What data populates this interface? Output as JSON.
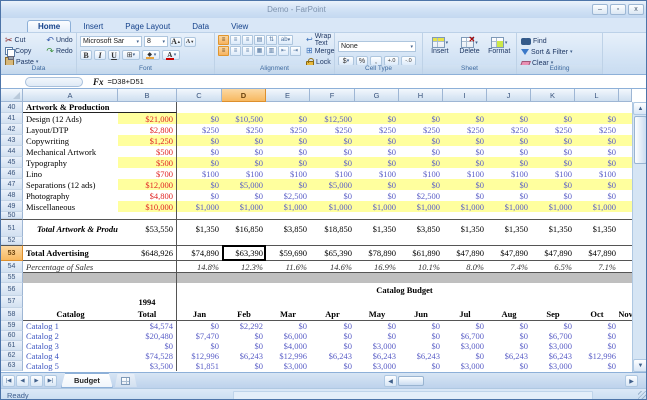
{
  "window": {
    "title": "Demo - FarPoint",
    "controls": {
      "minimize": "–",
      "maximize": "▫",
      "close": "x"
    }
  },
  "ribbon": {
    "tabs": [
      "Home",
      "Insert",
      "Page Layout",
      "Data",
      "View"
    ],
    "active_tab": "Home",
    "data_group": {
      "label": "Data",
      "cut": "Cut",
      "copy": "Copy",
      "paste": "Paste",
      "undo": "Undo",
      "redo": "Redo"
    },
    "font_group": {
      "label": "Font",
      "font_name": "Microsoft Sar",
      "font_size": "8"
    },
    "align_group": {
      "label": "Alignment",
      "wrap": "Wrap Text",
      "merge": "Merge",
      "lock": "Lock"
    },
    "cell_type_group": {
      "label": "Cell Type",
      "value": "None",
      "currency": "$",
      "percent": "%",
      "comma": ",",
      "inc_decimal": "+.0",
      "dec_decimal": "-.0"
    },
    "sheet_group": {
      "label": "Sheet",
      "insert": "Insert",
      "delete": "Delete",
      "format": "Format"
    },
    "editing_group": {
      "label": "Editing",
      "find": "Find",
      "sort": "Sort & Filter",
      "clear": "Clear"
    }
  },
  "formula_bar": {
    "name_box": "",
    "fx_label": "Fx",
    "formula": "=D38+D51"
  },
  "sheet": {
    "selected": {
      "col": "D",
      "row": 53
    },
    "columns": [
      {
        "key": "RH",
        "label": "",
        "w": 22
      },
      {
        "key": "A",
        "label": "A",
        "w": 95
      },
      {
        "key": "B",
        "label": "B",
        "w": 59
      },
      {
        "key": "C",
        "label": "C",
        "w": 45
      },
      {
        "key": "D",
        "label": "D",
        "w": 44
      },
      {
        "key": "E",
        "label": "E",
        "w": 44
      },
      {
        "key": "F",
        "label": "F",
        "w": 45
      },
      {
        "key": "G",
        "label": "G",
        "w": 44
      },
      {
        "key": "H",
        "label": "H",
        "w": 44
      },
      {
        "key": "I",
        "label": "I",
        "w": 44
      },
      {
        "key": "J",
        "label": "J",
        "w": 44
      },
      {
        "key": "K",
        "label": "K",
        "w": 44
      },
      {
        "key": "L",
        "label": "L",
        "w": 44
      },
      {
        "key": "M",
        "label": "",
        "w": 13
      }
    ],
    "rows": [
      {
        "n": 40,
        "h": 11,
        "ul": true,
        "cells": {
          "A": [
            "Artwork & Production",
            "title"
          ]
        }
      },
      {
        "n": 41,
        "h": 11,
        "band": true,
        "cells": {
          "A": [
            "Design (12 Ads)",
            "lab"
          ],
          "B": [
            "$21,000",
            "red"
          ],
          "C": [
            "$0",
            "val"
          ],
          "D": [
            "$10,500",
            "val"
          ],
          "E": [
            "$0",
            "val"
          ],
          "F": [
            "$12,500",
            "val"
          ],
          "G": [
            "$0",
            "val"
          ],
          "H": [
            "$0",
            "val"
          ],
          "I": [
            "$0",
            "val"
          ],
          "J": [
            "$0",
            "val"
          ],
          "K": [
            "$0",
            "val"
          ],
          "L": [
            "$0",
            "val"
          ]
        }
      },
      {
        "n": 42,
        "h": 11,
        "cells": {
          "A": [
            "Layout/DTP",
            "lab"
          ],
          "B": [
            "$2,800",
            "red"
          ],
          "C": [
            "$250",
            "val"
          ],
          "D": [
            "$250",
            "val"
          ],
          "E": [
            "$250",
            "val"
          ],
          "F": [
            "$250",
            "val"
          ],
          "G": [
            "$250",
            "val"
          ],
          "H": [
            "$250",
            "val"
          ],
          "I": [
            "$250",
            "val"
          ],
          "J": [
            "$250",
            "val"
          ],
          "K": [
            "$250",
            "val"
          ],
          "L": [
            "$250",
            "val"
          ]
        }
      },
      {
        "n": 43,
        "h": 11,
        "band": true,
        "cells": {
          "A": [
            "Copywriting",
            "lab"
          ],
          "B": [
            "$1,250",
            "red"
          ],
          "C": [
            "$0",
            "val"
          ],
          "D": [
            "$0",
            "val"
          ],
          "E": [
            "$0",
            "val"
          ],
          "F": [
            "$0",
            "val"
          ],
          "G": [
            "$0",
            "val"
          ],
          "H": [
            "$0",
            "val"
          ],
          "I": [
            "$0",
            "val"
          ],
          "J": [
            "$0",
            "val"
          ],
          "K": [
            "$0",
            "val"
          ],
          "L": [
            "$0",
            "val"
          ]
        }
      },
      {
        "n": 44,
        "h": 11,
        "cells": {
          "A": [
            "Mechanical Artwork",
            "lab"
          ],
          "B": [
            "$500",
            "red"
          ],
          "C": [
            "$0",
            "val"
          ],
          "D": [
            "$0",
            "val"
          ],
          "E": [
            "$0",
            "val"
          ],
          "F": [
            "$0",
            "val"
          ],
          "G": [
            "$0",
            "val"
          ],
          "H": [
            "$0",
            "val"
          ],
          "I": [
            "$0",
            "val"
          ],
          "J": [
            "$0",
            "val"
          ],
          "K": [
            "$0",
            "val"
          ],
          "L": [
            "$0",
            "val"
          ]
        }
      },
      {
        "n": 45,
        "h": 11,
        "band": true,
        "cells": {
          "A": [
            "Typography",
            "lab"
          ],
          "B": [
            "$500",
            "red"
          ],
          "C": [
            "$0",
            "val"
          ],
          "D": [
            "$0",
            "val"
          ],
          "E": [
            "$0",
            "val"
          ],
          "F": [
            "$0",
            "val"
          ],
          "G": [
            "$0",
            "val"
          ],
          "H": [
            "$0",
            "val"
          ],
          "I": [
            "$0",
            "val"
          ],
          "J": [
            "$0",
            "val"
          ],
          "K": [
            "$0",
            "val"
          ],
          "L": [
            "$0",
            "val"
          ]
        }
      },
      {
        "n": 46,
        "h": 11,
        "cells": {
          "A": [
            "Lino",
            "lab"
          ],
          "B": [
            "$700",
            "red"
          ],
          "C": [
            "$100",
            "val"
          ],
          "D": [
            "$100",
            "val"
          ],
          "E": [
            "$100",
            "val"
          ],
          "F": [
            "$100",
            "val"
          ],
          "G": [
            "$100",
            "val"
          ],
          "H": [
            "$100",
            "val"
          ],
          "I": [
            "$100",
            "val"
          ],
          "J": [
            "$100",
            "val"
          ],
          "K": [
            "$100",
            "val"
          ],
          "L": [
            "$100",
            "val"
          ]
        }
      },
      {
        "n": 47,
        "h": 11,
        "band": true,
        "cells": {
          "A": [
            "Separations (12 ads)",
            "lab"
          ],
          "B": [
            "$12,000",
            "red"
          ],
          "C": [
            "$0",
            "val"
          ],
          "D": [
            "$5,000",
            "val"
          ],
          "E": [
            "$0",
            "val"
          ],
          "F": [
            "$5,000",
            "val"
          ],
          "G": [
            "$0",
            "val"
          ],
          "H": [
            "$0",
            "val"
          ],
          "I": [
            "$0",
            "val"
          ],
          "J": [
            "$0",
            "val"
          ],
          "K": [
            "$0",
            "val"
          ],
          "L": [
            "$0",
            "val"
          ]
        }
      },
      {
        "n": 48,
        "h": 11,
        "cells": {
          "A": [
            "Photography",
            "lab"
          ],
          "B": [
            "$4,800",
            "red"
          ],
          "C": [
            "$0",
            "val"
          ],
          "D": [
            "$0",
            "val"
          ],
          "E": [
            "$2,500",
            "val"
          ],
          "F": [
            "$0",
            "val"
          ],
          "G": [
            "$0",
            "val"
          ],
          "H": [
            "$2,500",
            "val"
          ],
          "I": [
            "$0",
            "val"
          ],
          "J": [
            "$0",
            "val"
          ],
          "K": [
            "$0",
            "val"
          ],
          "L": [
            "$0",
            "val"
          ]
        }
      },
      {
        "n": 49,
        "h": 11,
        "band": true,
        "cells": {
          "A": [
            "Miscellaneous",
            "lab"
          ],
          "B": [
            "$10,000",
            "red"
          ],
          "C": [
            "$1,000",
            "val"
          ],
          "D": [
            "$1,000",
            "val"
          ],
          "E": [
            "$1,000",
            "val"
          ],
          "F": [
            "$1,000",
            "val"
          ],
          "G": [
            "$1,000",
            "val"
          ],
          "H": [
            "$1,000",
            "val"
          ],
          "I": [
            "$1,000",
            "val"
          ],
          "J": [
            "$1,000",
            "val"
          ],
          "K": [
            "$1,000",
            "val"
          ],
          "L": [
            "$1,000",
            "val"
          ]
        }
      },
      {
        "n": 50,
        "h": 7,
        "cells": {}
      },
      {
        "n": 51,
        "h": 18,
        "bt": true,
        "cells": {
          "A": [
            "Total Artwork & Production",
            "tot"
          ],
          "B": [
            "$53,550",
            "blk"
          ],
          "C": [
            "$1,350",
            "blk"
          ],
          "D": [
            "$16,850",
            "blk"
          ],
          "E": [
            "$3,850",
            "blk"
          ],
          "F": [
            "$18,850",
            "blk"
          ],
          "G": [
            "$1,350",
            "blk"
          ],
          "H": [
            "$3,850",
            "blk"
          ],
          "I": [
            "$1,350",
            "blk"
          ],
          "J": [
            "$1,350",
            "blk"
          ],
          "K": [
            "$1,350",
            "blk"
          ],
          "L": [
            "$1,350",
            "blk"
          ]
        }
      },
      {
        "n": 52,
        "h": 8,
        "cells": {}
      },
      {
        "n": 53,
        "h": 16,
        "bt": true,
        "bb": true,
        "cells": {
          "A": [
            "Total Advertising",
            "title"
          ],
          "B": [
            "$648,926",
            "blk"
          ],
          "C": [
            "$74,890",
            "blk"
          ],
          "D": [
            "$63,390",
            "blk"
          ],
          "E": [
            "$59,690",
            "blk"
          ],
          "F": [
            "$65,390",
            "blk"
          ],
          "G": [
            "$78,890",
            "blk"
          ],
          "H": [
            "$61,890",
            "blk"
          ],
          "I": [
            "$47,890",
            "blk"
          ],
          "J": [
            "$47,890",
            "blk"
          ],
          "K": [
            "$47,890",
            "blk"
          ],
          "L": [
            "$47,890",
            "blk"
          ]
        }
      },
      {
        "n": 54,
        "h": 12,
        "bb": true,
        "cells": {
          "A": [
            "Percentage of Sales",
            "ital"
          ],
          "C": [
            "14.8%",
            "pct"
          ],
          "D": [
            "12.3%",
            "pct"
          ],
          "E": [
            "11.6%",
            "pct"
          ],
          "F": [
            "14.6%",
            "pct"
          ],
          "G": [
            "16.9%",
            "pct"
          ],
          "H": [
            "10.1%",
            "pct"
          ],
          "I": [
            "8.0%",
            "pct"
          ],
          "J": [
            "7.4%",
            "pct"
          ],
          "K": [
            "6.5%",
            "pct"
          ],
          "L": [
            "7.1%",
            "pct"
          ]
        }
      },
      {
        "n": 55,
        "h": 10,
        "gray": true,
        "cells": {}
      },
      {
        "n": 56,
        "h": 13,
        "span_title": "Catalog Budget",
        "cells": {}
      },
      {
        "n": 57,
        "h": 12,
        "cells": {
          "B": [
            "1994",
            "hdr"
          ]
        }
      },
      {
        "n": 58,
        "h": 13,
        "bb": true,
        "cells": {
          "A": [
            "Catalog",
            "hdr"
          ],
          "B": [
            "Total",
            "hdr"
          ],
          "C": [
            "Jan",
            "hdr"
          ],
          "D": [
            "Feb",
            "hdr"
          ],
          "E": [
            "Mar",
            "hdr"
          ],
          "F": [
            "Apr",
            "hdr"
          ],
          "G": [
            "May",
            "hdr"
          ],
          "H": [
            "Jun",
            "hdr"
          ],
          "I": [
            "Jul",
            "hdr"
          ],
          "J": [
            "Aug",
            "hdr"
          ],
          "K": [
            "Sep",
            "hdr"
          ],
          "L": [
            "Oct",
            "hdr"
          ],
          "M": [
            "Nov",
            "hdr"
          ]
        }
      },
      {
        "n": 59,
        "h": 10,
        "cells": {
          "A": [
            "Catalog 1",
            "link"
          ],
          "B": [
            "$4,574",
            "val"
          ],
          "C": [
            "$0",
            "val"
          ],
          "D": [
            "$2,292",
            "val"
          ],
          "E": [
            "$0",
            "val"
          ],
          "F": [
            "$0",
            "val"
          ],
          "G": [
            "$0",
            "val"
          ],
          "H": [
            "$0",
            "val"
          ],
          "I": [
            "$0",
            "val"
          ],
          "J": [
            "$0",
            "val"
          ],
          "K": [
            "$0",
            "val"
          ],
          "L": [
            "$0",
            "val"
          ]
        }
      },
      {
        "n": 60,
        "h": 10,
        "cells": {
          "A": [
            "Catalog 2",
            "link"
          ],
          "B": [
            "$20,480",
            "val"
          ],
          "C": [
            "$7,470",
            "val"
          ],
          "D": [
            "$0",
            "val"
          ],
          "E": [
            "$6,000",
            "val"
          ],
          "F": [
            "$0",
            "val"
          ],
          "G": [
            "$0",
            "val"
          ],
          "H": [
            "$0",
            "val"
          ],
          "I": [
            "$6,700",
            "val"
          ],
          "J": [
            "$0",
            "val"
          ],
          "K": [
            "$6,700",
            "val"
          ],
          "L": [
            "$0",
            "val"
          ]
        }
      },
      {
        "n": 61,
        "h": 10,
        "cells": {
          "A": [
            "Catalog 3",
            "link"
          ],
          "B": [
            "$0",
            "val"
          ],
          "C": [
            "$0",
            "val"
          ],
          "D": [
            "$0",
            "val"
          ],
          "E": [
            "$4,000",
            "val"
          ],
          "F": [
            "$0",
            "val"
          ],
          "G": [
            "$3,000",
            "val"
          ],
          "H": [
            "$0",
            "val"
          ],
          "I": [
            "$3,000",
            "val"
          ],
          "J": [
            "$0",
            "val"
          ],
          "K": [
            "$3,000",
            "val"
          ],
          "L": [
            "$0",
            "val"
          ]
        }
      },
      {
        "n": 62,
        "h": 10,
        "cells": {
          "A": [
            "Catalog 4",
            "link"
          ],
          "B": [
            "$74,528",
            "val"
          ],
          "C": [
            "$12,996",
            "val"
          ],
          "D": [
            "$6,243",
            "val"
          ],
          "E": [
            "$12,996",
            "val"
          ],
          "F": [
            "$6,243",
            "val"
          ],
          "G": [
            "$6,243",
            "val"
          ],
          "H": [
            "$6,243",
            "val"
          ],
          "I": [
            "$0",
            "val"
          ],
          "J": [
            "$6,243",
            "val"
          ],
          "K": [
            "$6,243",
            "val"
          ],
          "L": [
            "$12,996",
            "val"
          ]
        }
      },
      {
        "n": 63,
        "h": 10,
        "cells": {
          "A": [
            "Catalog 5",
            "link"
          ],
          "B": [
            "$3,500",
            "val"
          ],
          "C": [
            "$1,851",
            "val"
          ],
          "D": [
            "$0",
            "val"
          ],
          "E": [
            "$3,000",
            "val"
          ],
          "F": [
            "$0",
            "val"
          ],
          "G": [
            "$3,000",
            "val"
          ],
          "H": [
            "$0",
            "val"
          ],
          "I": [
            "$3,000",
            "val"
          ],
          "J": [
            "$0",
            "val"
          ],
          "K": [
            "$3,000",
            "val"
          ],
          "L": [
            "$0",
            "val"
          ]
        }
      }
    ]
  },
  "tabs_bar": {
    "active_sheet": "Budget"
  },
  "status_bar": {
    "text": "Ready"
  },
  "colors": {
    "band": "#FFFF9E",
    "red_value": "#E02525",
    "blue_value": "#5B5FC7",
    "link": "#3D55C0",
    "gray_band": "#BFBFBF",
    "selection_orange": "#F7B860"
  }
}
